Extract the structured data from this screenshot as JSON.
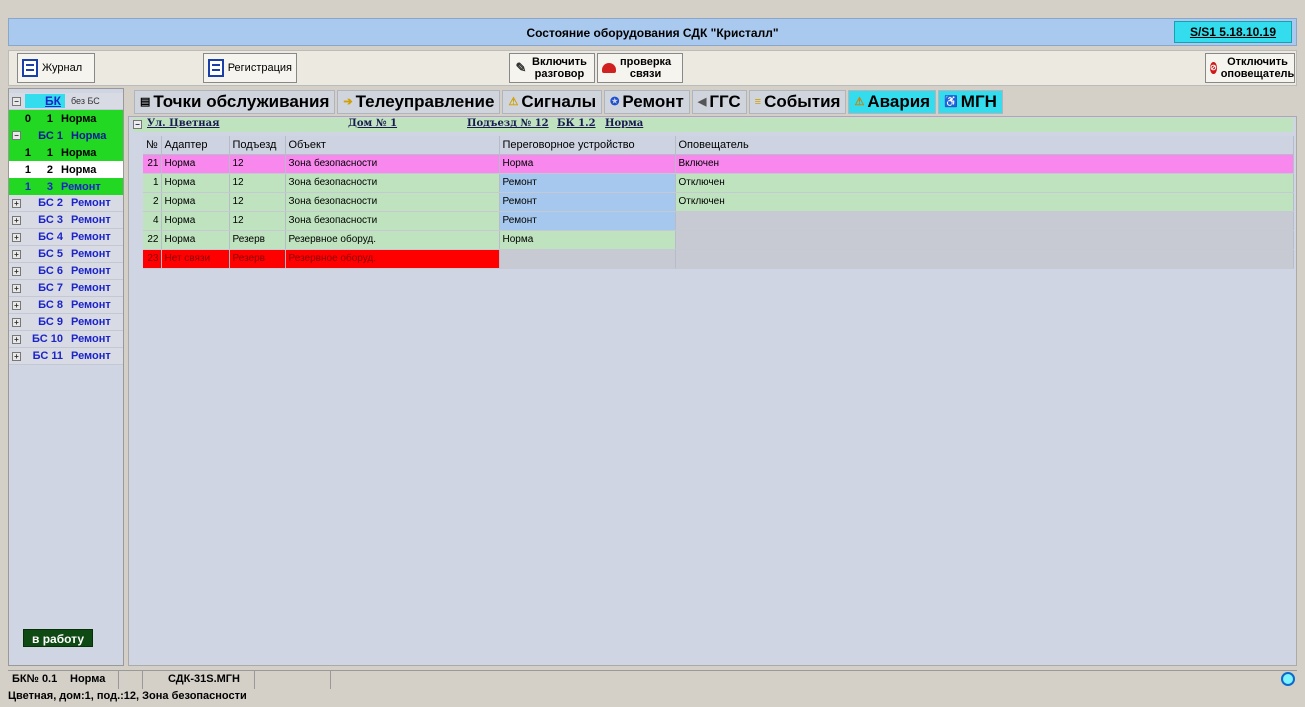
{
  "window": {
    "title": "Состояние оборудования СДК \"Кристалл\"",
    "version": "S/S1 5.18.10.19"
  },
  "toolbar": {
    "journal": "Журнал",
    "registration": "Регистрация",
    "talk_l1": "Включить",
    "talk_l2": "разговор",
    "check_l1": "проверка",
    "check_l2": "связи",
    "notifier_l1": "Отключить",
    "notifier_l2": "оповещатель"
  },
  "tree": {
    "header": {
      "name": "БК",
      "status": "без БС"
    },
    "rows": [
      {
        "a": "0",
        "b": "1",
        "status": "Норма"
      },
      {
        "name": "БС 1",
        "status": "Норма"
      },
      {
        "a": "1",
        "b": "1",
        "status": "Норма"
      },
      {
        "a": "1",
        "b": "2",
        "status": "Норма"
      },
      {
        "a": "1",
        "b": "3",
        "status": "Ремонт"
      },
      {
        "name": "БС 2",
        "status": "Ремонт"
      },
      {
        "name": "БС 3",
        "status": "Ремонт"
      },
      {
        "name": "БС 4",
        "status": "Ремонт"
      },
      {
        "name": "БС 5",
        "status": "Ремонт"
      },
      {
        "name": "БС 6",
        "status": "Ремонт"
      },
      {
        "name": "БС 7",
        "status": "Ремонт"
      },
      {
        "name": "БС 8",
        "status": "Ремонт"
      },
      {
        "name": "БС 9",
        "status": "Ремонт"
      },
      {
        "name": "БС 10",
        "status": "Ремонт"
      },
      {
        "name": "БС 11",
        "status": "Ремонт"
      }
    ],
    "work_button": "в работу"
  },
  "tabs": [
    {
      "label": "Точки обслуживания"
    },
    {
      "label": "Телеуправление"
    },
    {
      "label": "Сигналы"
    },
    {
      "label": "Ремонт"
    },
    {
      "label": "ГГС"
    },
    {
      "label": "События"
    },
    {
      "label": "Авария"
    },
    {
      "label": "МГН"
    }
  ],
  "crumbs": {
    "street": "Ул. Цветная",
    "house": "Дом № 1",
    "entrance": "Подъезд № 12",
    "bk": "БК 1.2",
    "state": "Норма"
  },
  "table": {
    "columns": [
      "№",
      "Адаптер",
      "Подъезд",
      "Объект",
      "Переговорное устройство",
      "Оповещатель"
    ],
    "rows": [
      [
        "21",
        "Норма",
        "12",
        "Зона безопасности",
        "Норма",
        "Включен"
      ],
      [
        "1",
        "Норма",
        "12",
        "Зона безопасности",
        "Ремонт",
        "Отключен"
      ],
      [
        "2",
        "Норма",
        "12",
        "Зона безопасности",
        "Ремонт",
        "Отключен"
      ],
      [
        "4",
        "Норма",
        "12",
        "Зона безопасности",
        "Ремонт",
        ""
      ],
      [
        "22",
        "Норма",
        "Резерв",
        "Резервное оборуд.",
        "Норма",
        ""
      ],
      [
        "23",
        "Нет связи",
        "Резерв",
        "Резервное оборуд.",
        "",
        ""
      ]
    ]
  },
  "status": {
    "bk": "БК№ 0.1",
    "state": "Норма",
    "device": "СДК-31S.МГН",
    "footer": "Цветная, дом:1, под.:12, Зона безопасности"
  }
}
